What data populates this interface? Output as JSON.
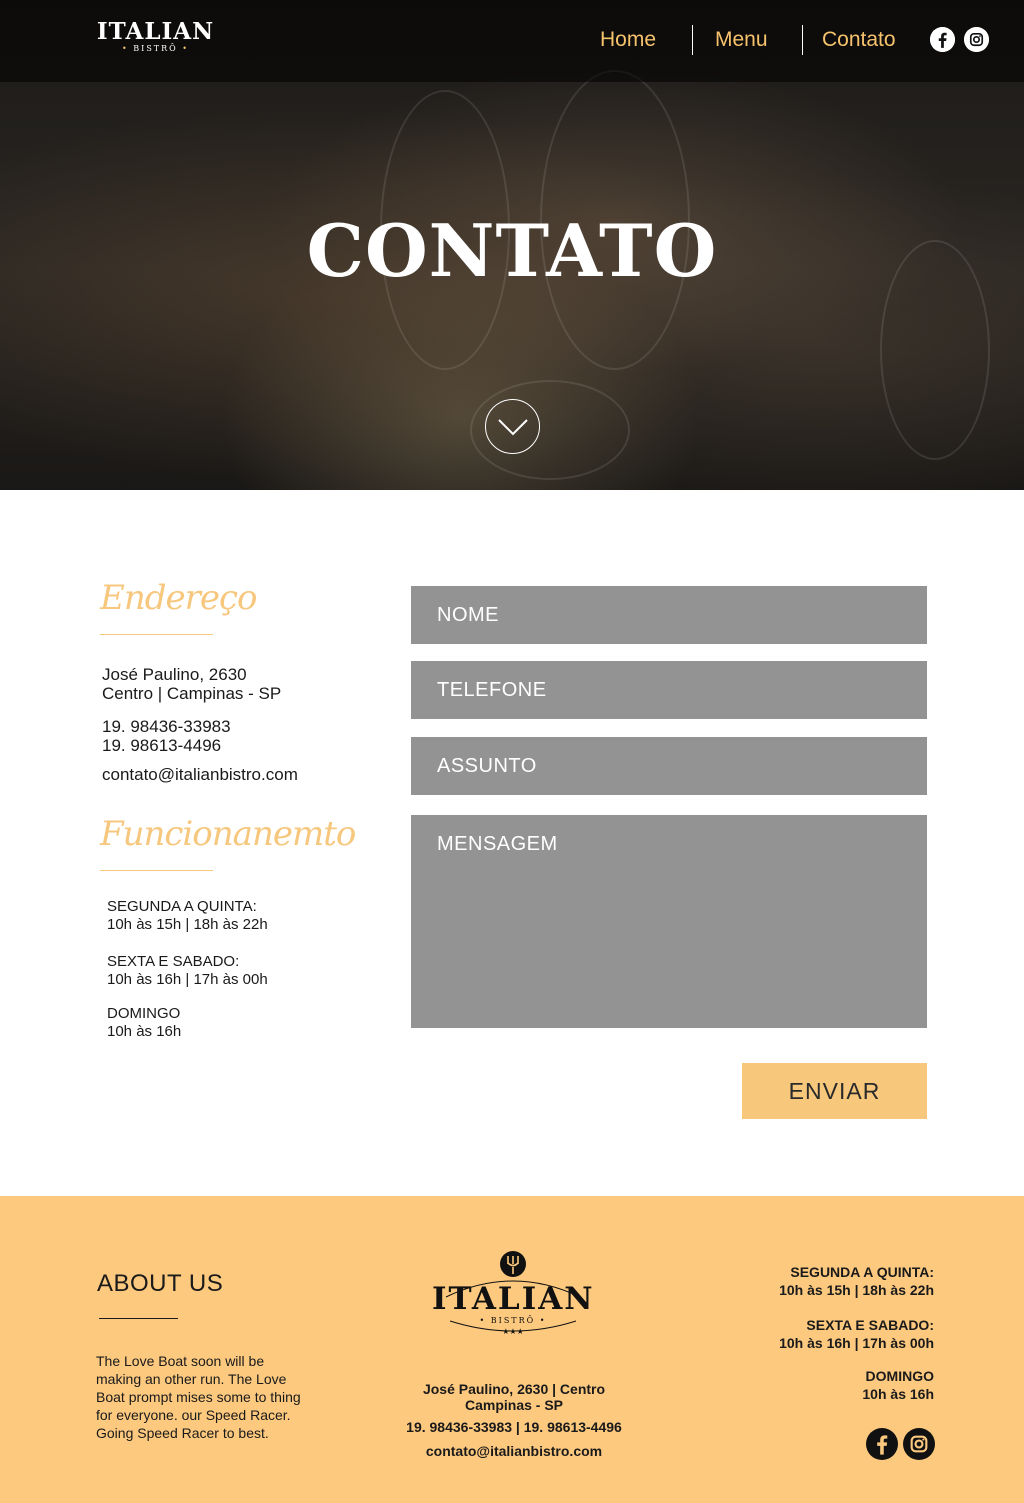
{
  "header": {
    "logo_word": "ITALIAN",
    "logo_sub": "BISTRÔ",
    "nav": [
      "Home",
      "Menu",
      "Contato"
    ],
    "social_icons": [
      "facebook-icon",
      "instagram-icon"
    ]
  },
  "hero": {
    "title": "CONTATO",
    "scroll_icon": "chevron-down-icon"
  },
  "contact": {
    "address_title": "Endereço",
    "address_line1": "José Paulino, 2630",
    "address_line2": "Centro | Campinas - SP",
    "phone1": "19. 98436-33983",
    "phone2": "19. 98613-4496",
    "email": "contato@italianbistro.com",
    "hours_title": "Funcionanemto",
    "hours": [
      {
        "days": "SEGUNDA A QUINTA:",
        "time": "10h às 15h | 18h às 22h"
      },
      {
        "days": "SEXTA E SABADO:",
        "time": "10h às 16h | 17h às 00h"
      },
      {
        "days": "DOMINGO",
        "time": "10h às 16h"
      }
    ]
  },
  "form": {
    "name_placeholder": "NOME",
    "phone_placeholder": "TELEFONE",
    "subject_placeholder": "ASSUNTO",
    "message_placeholder": "MENSAGEM",
    "submit_label": "ENVIAR"
  },
  "footer": {
    "about_title": "ABOUT US",
    "about_text": "The Love Boat soon will be making an other run. The Love Boat prompt mises some to thing for everyone. our Speed Racer. Going Speed Racer to best.",
    "logo_word": "ITALIAN",
    "logo_sub": "BISTRÔ",
    "logo_stars": "★★★",
    "address_line1": "José Paulino, 2630 | Centro",
    "address_line2": "Campinas - SP",
    "phones": "19. 98436-33983 | 19. 98613-4496",
    "email": "contato@italianbistro.com",
    "hours": [
      {
        "days": "SEGUNDA A QUINTA:",
        "time": "10h às 15h | 18h às 22h"
      },
      {
        "days": "SEXTA E SABADO:",
        "time": "10h às 16h | 17h às 00h"
      },
      {
        "days": "DOMINGO",
        "time": "10h às 16h"
      }
    ],
    "social_icons": [
      "facebook-icon",
      "instagram-icon"
    ]
  },
  "colors": {
    "accent": "#f6c26c",
    "footer_bg": "#fdc97f",
    "field_bg": "#939393",
    "button_bg": "#f7c77c"
  }
}
